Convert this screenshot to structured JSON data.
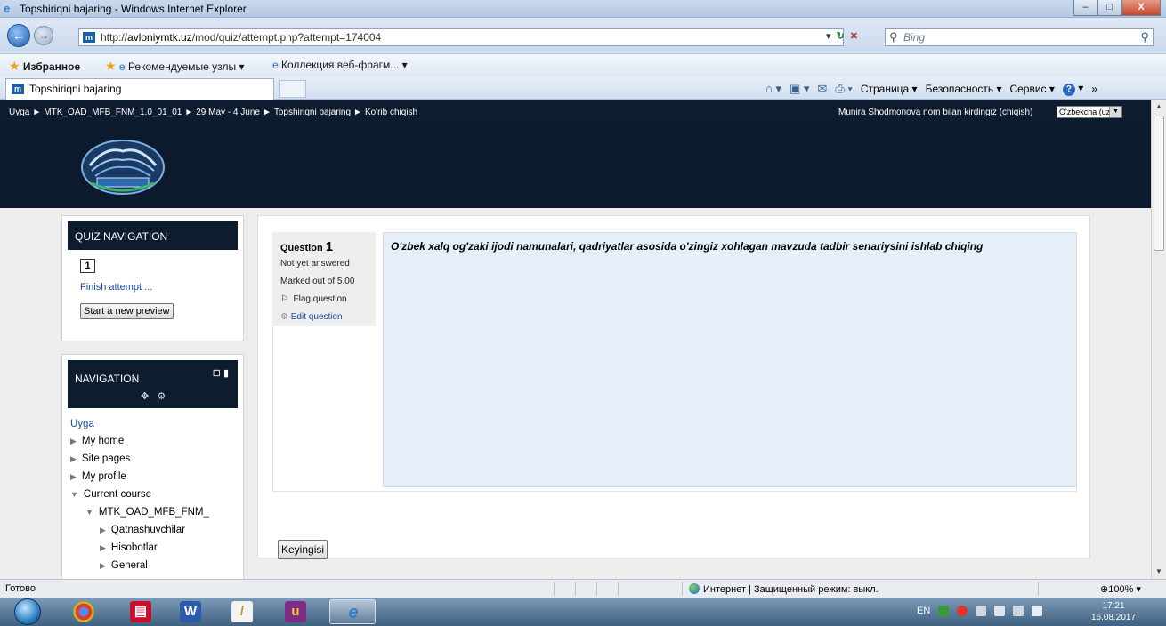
{
  "window": {
    "title": "Topshiriqni bajaring - Windows Internet Explorer",
    "controls": [
      "–",
      "□",
      "X"
    ]
  },
  "address_bar": {
    "url_prefix": "http://",
    "url_host": "avloniymtk.uz",
    "url_path": "/mod/quiz/attempt.php?attempt=174004",
    "search_placeholder": "Bing"
  },
  "favorites_bar": {
    "favorites": "Избранное",
    "suggested": "Рекомендуемые узлы ▾",
    "gallery": "Коллекция веб-фрагм... ▾"
  },
  "tab": {
    "label": "Topshiriqni bajaring"
  },
  "command_bar": {
    "page": "Страница ▾",
    "safety": "Безопасность ▾",
    "tools": "Сервис ▾"
  },
  "breadcrumb": {
    "items": [
      "Uyga",
      "MTK_OAD_MFB_FNM_1.0_01_01",
      "29 May - 4 June",
      "Topshiriqni bajaring",
      "Ko'rib chiqish"
    ],
    "separator": "►"
  },
  "login": {
    "text": "Munira Shodmonova nom bilan kirdingiz (chiqish)",
    "language": "O'zbekcha (uz)"
  },
  "quiz_navigation": {
    "title": "QUIZ NAVIGATION",
    "question_number": "1",
    "finish": "Finish attempt ...",
    "new_preview": "Start a new preview"
  },
  "navigation": {
    "title": "NAVIGATION",
    "home": "Uyga",
    "items": [
      "My home",
      "Site pages",
      "My profile",
      "Current course",
      "MTK_OAD_MFB_FNM_",
      "Qatnashuvchilar",
      "Hisobotlar",
      "General"
    ]
  },
  "question": {
    "label": "Question",
    "number": "1",
    "status": "Not yet answered",
    "marks": "Marked out of 5.00",
    "flag": "Flag question",
    "edit": "Edit question",
    "text": "O'zbek xalq og'zaki ijodi namunalari, qadriyatlar asosida o'zingiz xohlagan mavzuda tadbir senariysini ishlab chiqing"
  },
  "next_button": "Keyingisi",
  "status_bar": {
    "left": "Готово",
    "zone": "Интернет | Защищенный режим: выкл.",
    "zoom": "100%"
  },
  "taskbar": {
    "lang": "EN",
    "time": "17:21",
    "date": "16.08.2017"
  }
}
